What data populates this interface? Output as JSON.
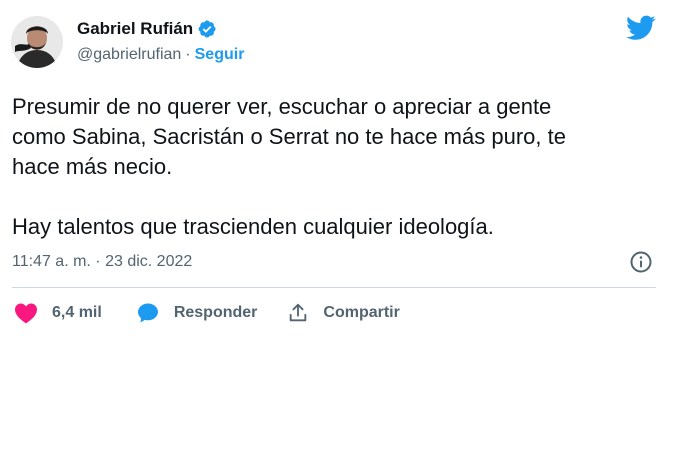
{
  "author": {
    "name": "Gabriel Rufián",
    "handle": "@gabrielrufian",
    "separator": "·",
    "follow_label": "Seguir",
    "verified": true
  },
  "tweet": {
    "text": "Presumir de no querer ver, escuchar o apreciar a gente\ncomo Sabina, Sacristán o Serrat no te hace más puro, te\nhace más necio.\n\nHay talentos que trascienden cualquier ideología.",
    "timestamp": "11:47 a. m. · 23 dic. 2022"
  },
  "actions": {
    "likes_count": "6,4 mil",
    "reply_label": "Responder",
    "share_label": "Compartir"
  },
  "icons": {
    "logo": "twitter-bird-icon",
    "verified": "verified-badge-icon",
    "info": "info-icon",
    "like": "heart-icon",
    "reply": "speech-bubble-icon",
    "share": "share-icon"
  },
  "colors": {
    "accent": "#1d9bf0",
    "like": "#f91880",
    "text": "#0f1419",
    "muted": "#536471",
    "divider": "#cfd9de"
  }
}
